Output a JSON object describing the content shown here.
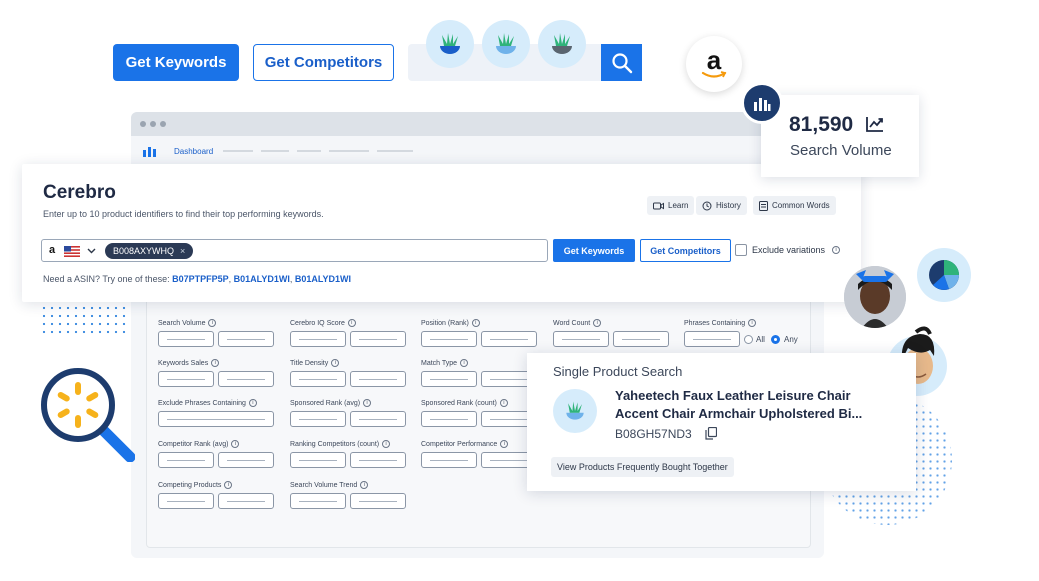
{
  "top": {
    "get_keywords_label": "Get Keywords",
    "get_competitors_label": "Get Competitors"
  },
  "amazon": {
    "glyph": "a"
  },
  "browser": {
    "nav_label": "Dashboard"
  },
  "cerebro": {
    "title": "Cerebro",
    "subtitle": "Enter up to 10 product identifiers to find their top performing keywords.",
    "pills": {
      "learn": "Learn",
      "history": "History",
      "common_words": "Common Words"
    },
    "marketplace_glyph": "a",
    "asin_chip": "B008AXYWHQ",
    "get_keywords_label": "Get Keywords",
    "get_competitors_label": "Get Competitors",
    "exclude_label": "Exclude variations",
    "hint_prefix": "Need a ASIN? Try one of these:",
    "examples": [
      "B07PTPFP5P",
      "B01ALYD1WI",
      "B01ALYD1WI"
    ]
  },
  "filters": {
    "search_volume": "Search Volume",
    "cerebro_iq": "Cerebro IQ Score",
    "position_rank": "Position (Rank)",
    "word_count": "Word Count",
    "phrases_containing": "Phrases Containing",
    "opt_all": "All",
    "opt_any": "Any",
    "keywords_sales": "Keywords Sales",
    "title_density": "Title Density",
    "match_type": "Match Type",
    "exclude_phrases": "Exclude Phrases Containing",
    "sponsored_rank_avg": "Sponsored Rank (avg)",
    "sponsored_rank_count": "Sponsored Rank (count)",
    "competitor_rank_avg": "Competitor Rank (avg)",
    "ranking_competitors": "Ranking Competitors (count)",
    "competitor_performance": "Competitor Performance",
    "competing_products": "Competing Products",
    "search_volume_trend": "Search Volume Trend"
  },
  "search_volume_card": {
    "value": "81,590",
    "label": "Search Volume"
  },
  "single_product": {
    "heading": "Single Product Search",
    "product_title_line1": "Yaheetech Faux Leather Leisure Chair",
    "product_title_line2": "Accent Chair Armchair Upholstered Bi...",
    "asin": "B08GH57ND3",
    "fbt_label": "View Products Frequently Bought Together"
  },
  "colors": {
    "primary": "#1a73e8",
    "navy": "#1d3c6e",
    "walmart_yellow": "#f6b21b",
    "light_blue": "#d6ecfb"
  },
  "icons": [
    "search-icon",
    "plant-icon",
    "amazon-icon",
    "bar-chart-icon",
    "trend-icon",
    "video-icon",
    "history-icon",
    "document-icon",
    "copy-icon",
    "info-icon",
    "walmart-icon",
    "magnifier-icon",
    "pie-chart-icon"
  ]
}
